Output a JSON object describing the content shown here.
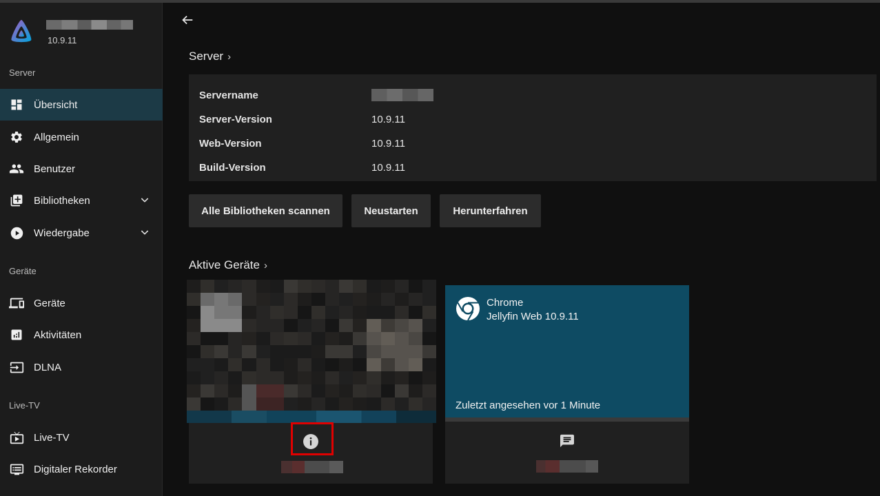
{
  "app": {
    "version": "10.9.11"
  },
  "sidebar": {
    "sections": {
      "server": "Server",
      "devices": "Geräte",
      "livetv": "Live-TV"
    },
    "items": [
      {
        "label": "Übersicht",
        "icon": "dashboard-icon"
      },
      {
        "label": "Allgemein",
        "icon": "gear-icon"
      },
      {
        "label": "Benutzer",
        "icon": "users-icon"
      },
      {
        "label": "Bibliotheken",
        "icon": "library-add-icon"
      },
      {
        "label": "Wiedergabe",
        "icon": "play-circle-icon"
      },
      {
        "label": "Geräte",
        "icon": "devices-icon"
      },
      {
        "label": "Aktivitäten",
        "icon": "analytics-icon"
      },
      {
        "label": "DLNA",
        "icon": "input-icon"
      },
      {
        "label": "Live-TV",
        "icon": "live-tv-icon"
      },
      {
        "label": "Digitaler Rekorder",
        "icon": "recorder-icon"
      }
    ]
  },
  "main": {
    "server_heading": "Server",
    "server_info": [
      {
        "key": "Servername",
        "value": ""
      },
      {
        "key": "Server-Version",
        "value": "10.9.11"
      },
      {
        "key": "Web-Version",
        "value": "10.9.11"
      },
      {
        "key": "Build-Version",
        "value": "10.9.11"
      }
    ],
    "buttons": {
      "scan": "Alle Bibliotheken scannen",
      "restart": "Neustarten",
      "shutdown": "Herunterfahren"
    },
    "devices_heading": "Aktive Geräte",
    "device2": {
      "client": "Chrome",
      "app": "Jellyfin Web 10.9.11",
      "last_seen": "Zuletzt angesehen vor 1 Minute"
    }
  },
  "colors": {
    "sidebar_bg": "#1c1c1c",
    "active_item": "#1c3a46",
    "card_accent": "#0e4b63",
    "highlight": "#e00000"
  }
}
